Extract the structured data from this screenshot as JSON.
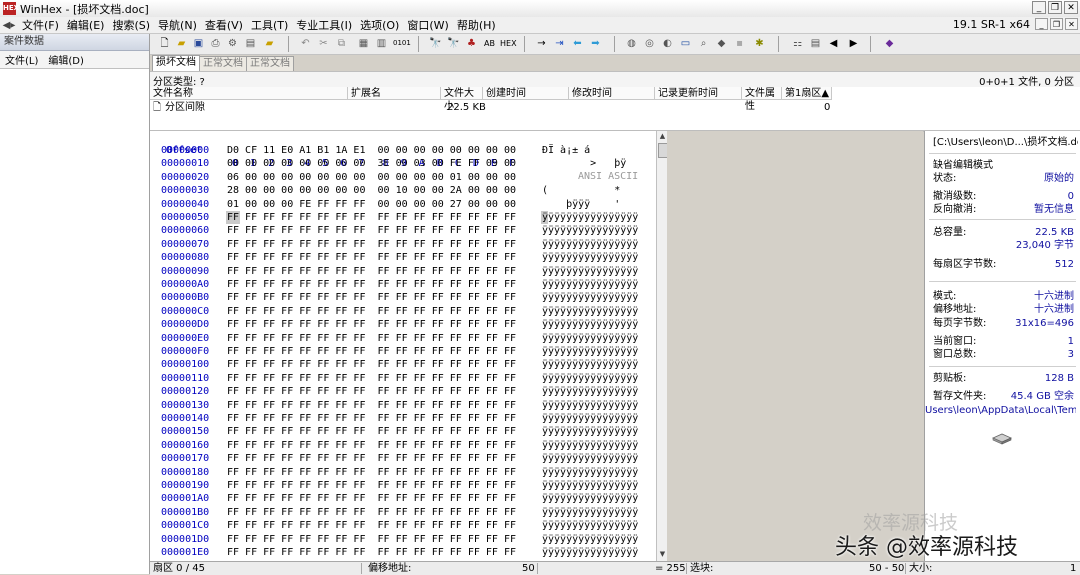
{
  "window": {
    "title": "WinHex - [损坏文档.doc]",
    "version": "19.1 SR-1 x64"
  },
  "menu": [
    "文件(F)",
    "编辑(E)",
    "搜索(S)",
    "导航(N)",
    "查看(V)",
    "工具(T)",
    "专业工具(I)",
    "选项(O)",
    "窗口(W)",
    "帮助(H)"
  ],
  "left_pane": {
    "title": "案件数据",
    "menu": [
      "文件(L)",
      "编辑(D)"
    ]
  },
  "tabs": [
    "损坏文档",
    "正常文档",
    "正常文档"
  ],
  "info_bar": {
    "partition_type": "分区类型: ?",
    "file_count": "0+0+1 文件, 0 分区"
  },
  "file_list": {
    "headers": [
      "文件名称",
      "扩展名",
      "文件大小",
      "创建时间",
      "修改时间",
      "记录更新时间",
      "文件属性",
      "第1扇区▲"
    ],
    "row": {
      "name": "分区间隙",
      "size": "22.5 KB",
      "first_sector": "0"
    }
  },
  "hex": {
    "header": {
      "offset": "Offset",
      "columns": "0  1  2  3  4  5  6  7   8  9  A  B  C  D  E  F",
      "ascii": "ANSI ASCII"
    },
    "rows": [
      {
        "offset": "00000000",
        "hex": "D0 CF 11 E0 A1 B1 1A E1  00 00 00 00 00 00 00 00",
        "ascii": "ÐÏ à¡± á"
      },
      {
        "offset": "00000010",
        "hex": "00 00 00 00 00 00 00 00  3E 00 03 00 FE FF 09 00",
        "ascii": "        >   þÿ"
      },
      {
        "offset": "00000020",
        "hex": "06 00 00 00 00 00 00 00  00 00 00 00 01 00 00 00",
        "ascii": ""
      },
      {
        "offset": "00000030",
        "hex": "28 00 00 00 00 00 00 00  00 10 00 00 2A 00 00 00",
        "ascii": "(           *"
      },
      {
        "offset": "00000040",
        "hex": "01 00 00 00 FE FF FF FF  00 00 00 00 27 00 00 00",
        "ascii": "    þÿÿÿ    '"
      },
      {
        "offset": "00000050",
        "hex": "FF FF FF FF FF FF FF FF  FF FF FF FF FF FF FF FF",
        "ascii": "ÿÿÿÿÿÿÿÿÿÿÿÿÿÿÿÿ"
      },
      {
        "offset": "00000060",
        "hex": "FF FF FF FF FF FF FF FF  FF FF FF FF FF FF FF FF",
        "ascii": "ÿÿÿÿÿÿÿÿÿÿÿÿÿÿÿÿ"
      },
      {
        "offset": "00000070",
        "hex": "FF FF FF FF FF FF FF FF  FF FF FF FF FF FF FF FF",
        "ascii": "ÿÿÿÿÿÿÿÿÿÿÿÿÿÿÿÿ"
      },
      {
        "offset": "00000080",
        "hex": "FF FF FF FF FF FF FF FF  FF FF FF FF FF FF FF FF",
        "ascii": "ÿÿÿÿÿÿÿÿÿÿÿÿÿÿÿÿ"
      },
      {
        "offset": "00000090",
        "hex": "FF FF FF FF FF FF FF FF  FF FF FF FF FF FF FF FF",
        "ascii": "ÿÿÿÿÿÿÿÿÿÿÿÿÿÿÿÿ"
      },
      {
        "offset": "000000A0",
        "hex": "FF FF FF FF FF FF FF FF  FF FF FF FF FF FF FF FF",
        "ascii": "ÿÿÿÿÿÿÿÿÿÿÿÿÿÿÿÿ"
      },
      {
        "offset": "000000B0",
        "hex": "FF FF FF FF FF FF FF FF  FF FF FF FF FF FF FF FF",
        "ascii": "ÿÿÿÿÿÿÿÿÿÿÿÿÿÿÿÿ"
      },
      {
        "offset": "000000C0",
        "hex": "FF FF FF FF FF FF FF FF  FF FF FF FF FF FF FF FF",
        "ascii": "ÿÿÿÿÿÿÿÿÿÿÿÿÿÿÿÿ"
      },
      {
        "offset": "000000D0",
        "hex": "FF FF FF FF FF FF FF FF  FF FF FF FF FF FF FF FF",
        "ascii": "ÿÿÿÿÿÿÿÿÿÿÿÿÿÿÿÿ"
      },
      {
        "offset": "000000E0",
        "hex": "FF FF FF FF FF FF FF FF  FF FF FF FF FF FF FF FF",
        "ascii": "ÿÿÿÿÿÿÿÿÿÿÿÿÿÿÿÿ"
      },
      {
        "offset": "000000F0",
        "hex": "FF FF FF FF FF FF FF FF  FF FF FF FF FF FF FF FF",
        "ascii": "ÿÿÿÿÿÿÿÿÿÿÿÿÿÿÿÿ"
      },
      {
        "offset": "00000100",
        "hex": "FF FF FF FF FF FF FF FF  FF FF FF FF FF FF FF FF",
        "ascii": "ÿÿÿÿÿÿÿÿÿÿÿÿÿÿÿÿ"
      },
      {
        "offset": "00000110",
        "hex": "FF FF FF FF FF FF FF FF  FF FF FF FF FF FF FF FF",
        "ascii": "ÿÿÿÿÿÿÿÿÿÿÿÿÿÿÿÿ"
      },
      {
        "offset": "00000120",
        "hex": "FF FF FF FF FF FF FF FF  FF FF FF FF FF FF FF FF",
        "ascii": "ÿÿÿÿÿÿÿÿÿÿÿÿÿÿÿÿ"
      },
      {
        "offset": "00000130",
        "hex": "FF FF FF FF FF FF FF FF  FF FF FF FF FF FF FF FF",
        "ascii": "ÿÿÿÿÿÿÿÿÿÿÿÿÿÿÿÿ"
      },
      {
        "offset": "00000140",
        "hex": "FF FF FF FF FF FF FF FF  FF FF FF FF FF FF FF FF",
        "ascii": "ÿÿÿÿÿÿÿÿÿÿÿÿÿÿÿÿ"
      },
      {
        "offset": "00000150",
        "hex": "FF FF FF FF FF FF FF FF  FF FF FF FF FF FF FF FF",
        "ascii": "ÿÿÿÿÿÿÿÿÿÿÿÿÿÿÿÿ"
      },
      {
        "offset": "00000160",
        "hex": "FF FF FF FF FF FF FF FF  FF FF FF FF FF FF FF FF",
        "ascii": "ÿÿÿÿÿÿÿÿÿÿÿÿÿÿÿÿ"
      },
      {
        "offset": "00000170",
        "hex": "FF FF FF FF FF FF FF FF  FF FF FF FF FF FF FF FF",
        "ascii": "ÿÿÿÿÿÿÿÿÿÿÿÿÿÿÿÿ"
      },
      {
        "offset": "00000180",
        "hex": "FF FF FF FF FF FF FF FF  FF FF FF FF FF FF FF FF",
        "ascii": "ÿÿÿÿÿÿÿÿÿÿÿÿÿÿÿÿ"
      },
      {
        "offset": "00000190",
        "hex": "FF FF FF FF FF FF FF FF  FF FF FF FF FF FF FF FF",
        "ascii": "ÿÿÿÿÿÿÿÿÿÿÿÿÿÿÿÿ"
      },
      {
        "offset": "000001A0",
        "hex": "FF FF FF FF FF FF FF FF  FF FF FF FF FF FF FF FF",
        "ascii": "ÿÿÿÿÿÿÿÿÿÿÿÿÿÿÿÿ"
      },
      {
        "offset": "000001B0",
        "hex": "FF FF FF FF FF FF FF FF  FF FF FF FF FF FF FF FF",
        "ascii": "ÿÿÿÿÿÿÿÿÿÿÿÿÿÿÿÿ"
      },
      {
        "offset": "000001C0",
        "hex": "FF FF FF FF FF FF FF FF  FF FF FF FF FF FF FF FF",
        "ascii": "ÿÿÿÿÿÿÿÿÿÿÿÿÿÿÿÿ"
      },
      {
        "offset": "000001D0",
        "hex": "FF FF FF FF FF FF FF FF  FF FF FF FF FF FF FF FF",
        "ascii": "ÿÿÿÿÿÿÿÿÿÿÿÿÿÿÿÿ"
      },
      {
        "offset": "000001E0",
        "hex": "FF FF FF FF FF FF FF FF  FF FF FF FF FF FF FF FF",
        "ascii": "ÿÿÿÿÿÿÿÿÿÿÿÿÿÿÿÿ"
      }
    ]
  },
  "info_panel": {
    "path": "[C:\\Users\\leon\\D...\\损坏文档.doc]",
    "edit_mode": "缺省编辑模式",
    "state_label": "状态:",
    "state_value": "原始的",
    "undo_levels_label": "撤消级数:",
    "undo_levels_value": "0",
    "reverse_undo_label": "反向撤消:",
    "reverse_undo_value": "暂无信息",
    "capacity_label": "总容量:",
    "capacity_kb": "22.5 KB",
    "capacity_bytes": "23,040 字节",
    "sector_bytes_label": "每扇区字节数:",
    "sector_bytes_value": "512",
    "mode_label": "模式:",
    "mode_value": "十六进制",
    "offset_addr_label": "偏移地址:",
    "offset_addr_value": "十六进制",
    "page_bytes_label": "每页字节数:",
    "page_bytes_value": "31x16=496",
    "current_window_label": "当前窗口:",
    "current_window_value": "1",
    "window_total_label": "窗口总数:",
    "window_total_value": "3",
    "clipboard_label": "剪贴板:",
    "clipboard_value": "128 B",
    "temp_folder_label": "暂存文件夹:",
    "temp_folder_value": "45.4 GB 空余",
    "temp_path": "Users\\leon\\AppData\\Local\\Temp"
  },
  "statusbar": {
    "sector": "扇区 0 / 45",
    "offset_label": "偏移地址:",
    "offset_value": "50",
    "equals": "= 255",
    "block_label": "选块:",
    "block_value": "50 - 50",
    "size_label": "大小:",
    "size_value": "1"
  },
  "watermark": {
    "main": "头条 @效率源科技",
    "faint": "效率源科技"
  }
}
